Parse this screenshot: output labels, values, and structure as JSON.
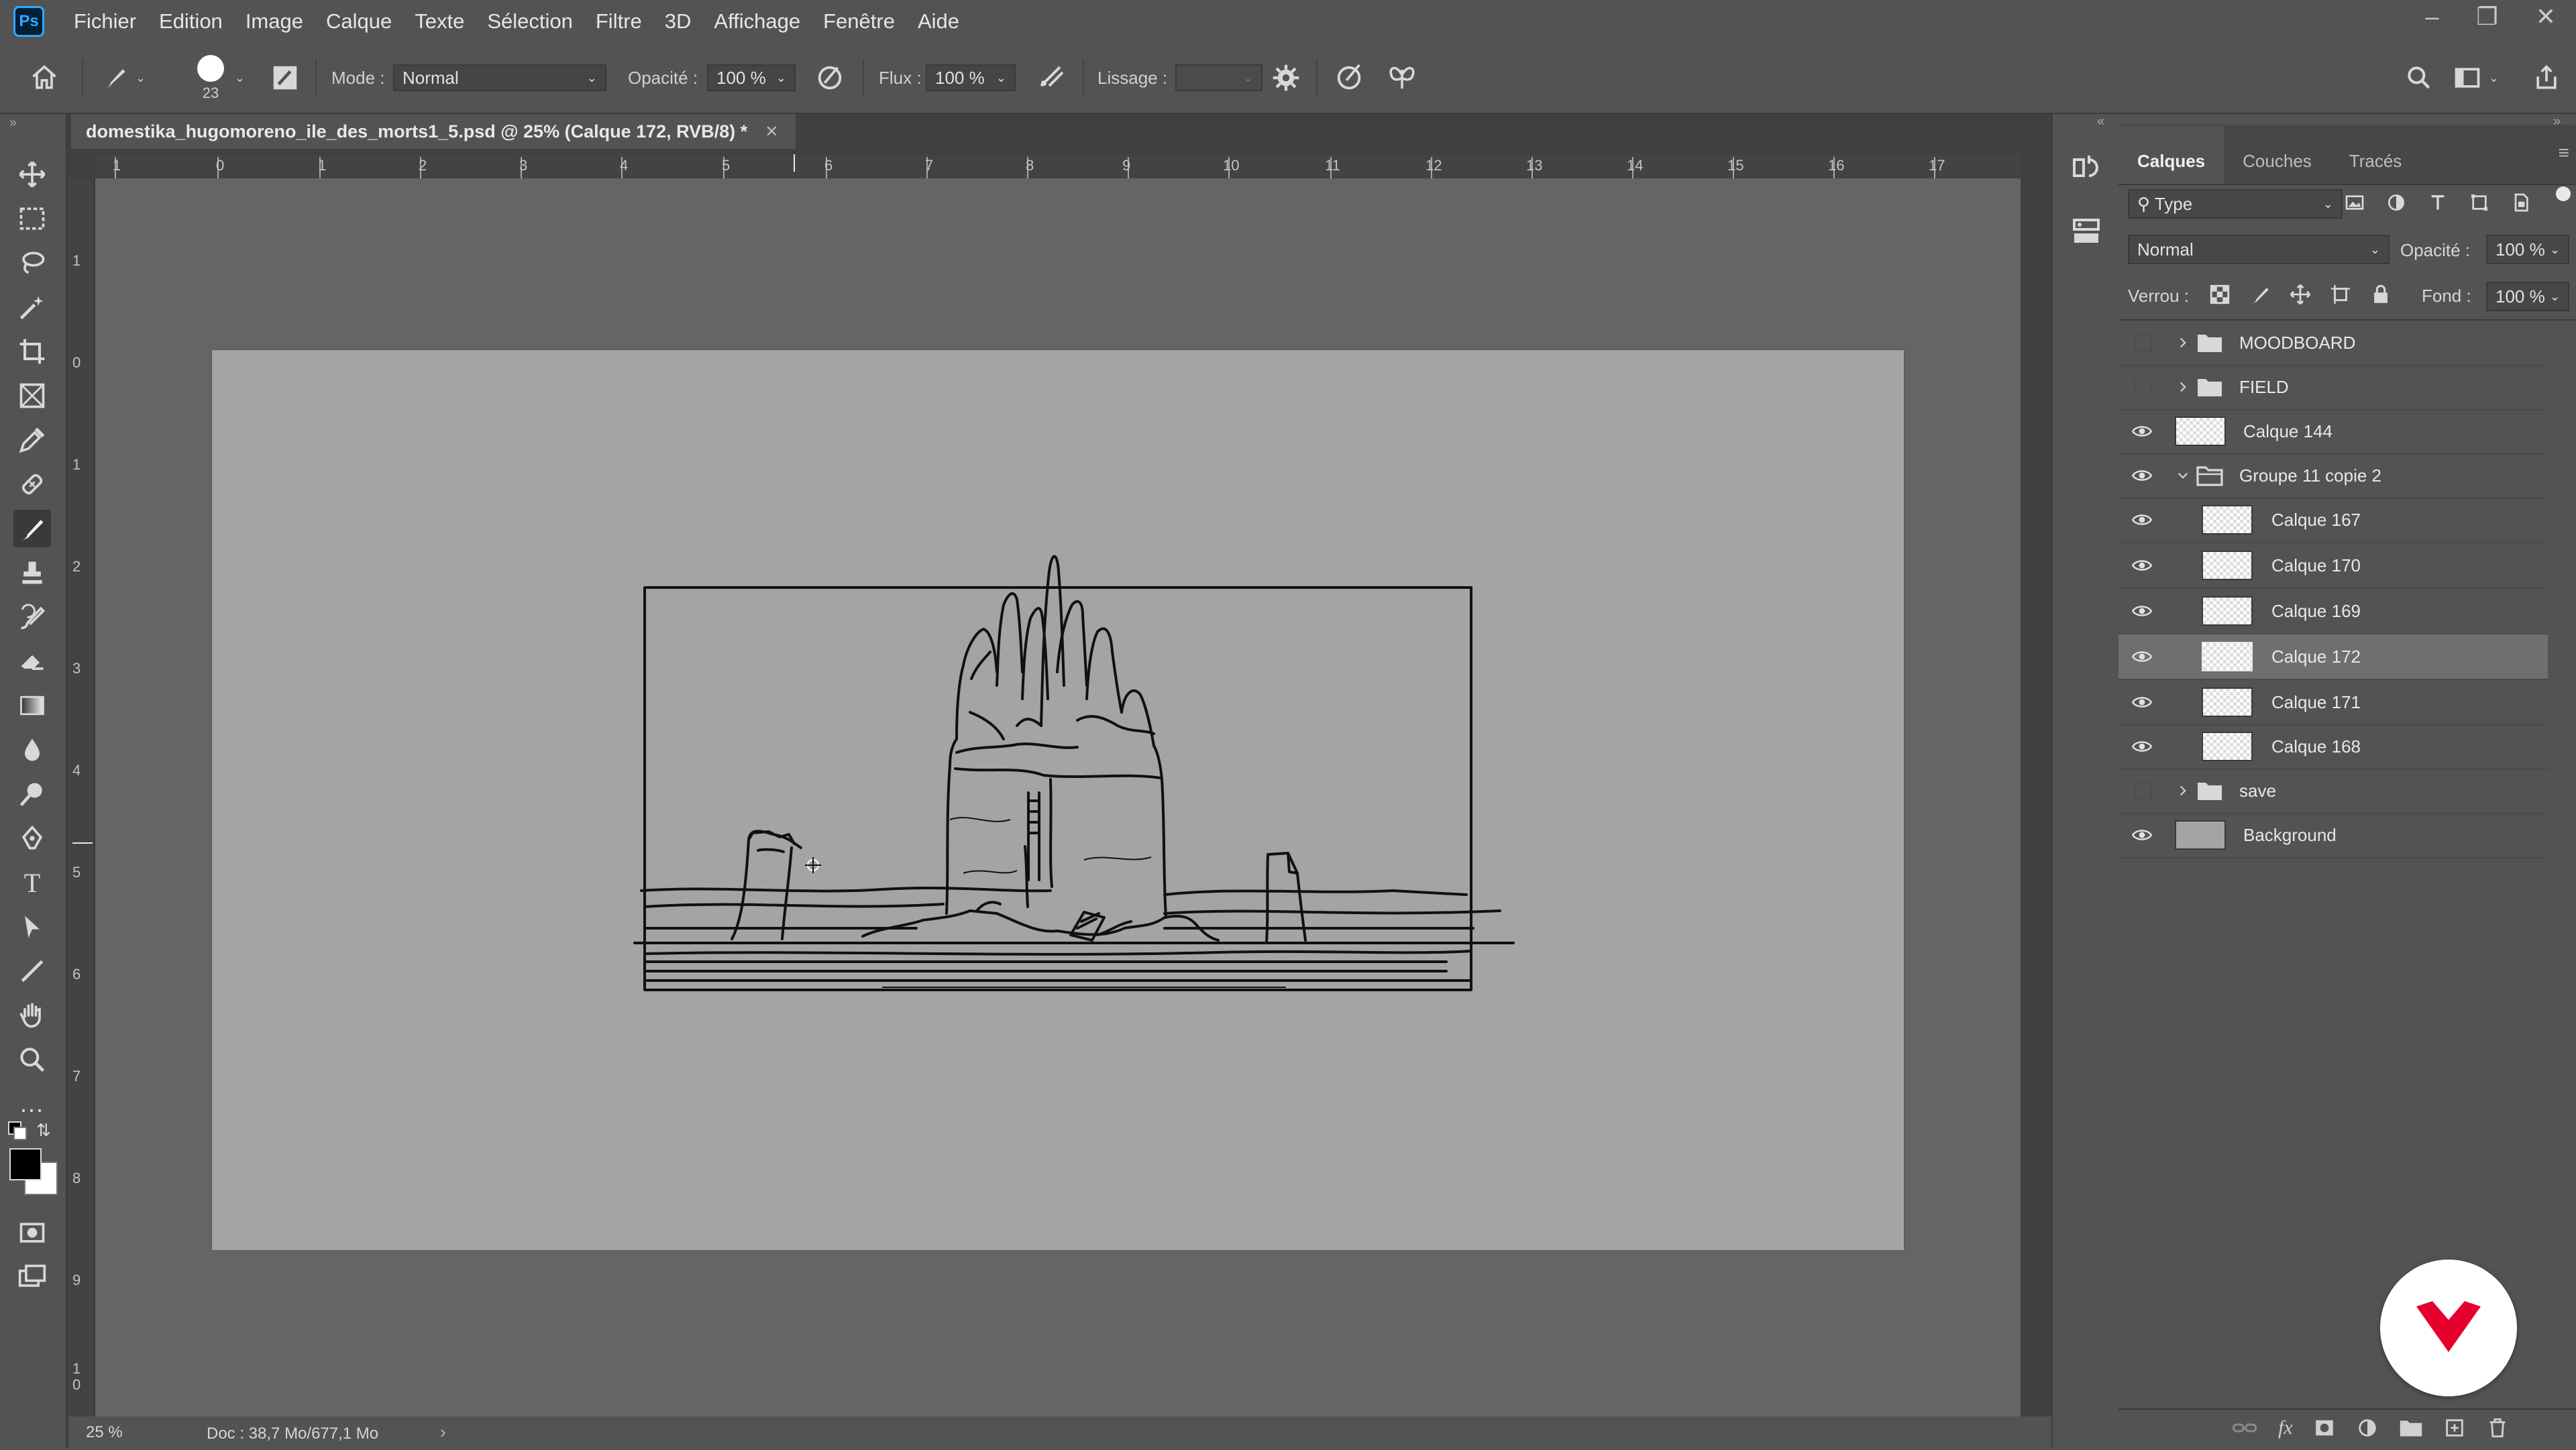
{
  "app": {
    "logo_text": "Ps"
  },
  "menu": [
    "Fichier",
    "Edition",
    "Image",
    "Calque",
    "Texte",
    "Sélection",
    "Filtre",
    "3D",
    "Affichage",
    "Fenêtre",
    "Aide"
  ],
  "options": {
    "brush_size": "23",
    "mode_label": "Mode :",
    "mode_value": "Normal",
    "opacity_label": "Opacité :",
    "opacity_value": "100 %",
    "flux_label": "Flux :",
    "flux_value": "100 %",
    "lissage_label": "Lissage :",
    "lissage_value": ""
  },
  "document": {
    "tab_title": "domestika_hugomoreno_ile_des_morts1_5.psd @ 25% (Calque 172, RVB/8) *",
    "zoom": "25 %",
    "doc_info": "Doc : 38,7 Mo/677,1 Mo",
    "ruler_top": [
      "1",
      "0",
      "1",
      "2",
      "3",
      "4",
      "5",
      "6",
      "7",
      "8",
      "9",
      "10",
      "11",
      "12",
      "13",
      "14",
      "15",
      "16",
      "17"
    ],
    "ruler_left": [
      "1",
      "0",
      "1",
      "2",
      "3",
      "4",
      "5",
      "6",
      "7",
      "8",
      "9",
      "1",
      "0"
    ]
  },
  "layers_panel": {
    "tabs": [
      "Calques",
      "Couches",
      "Tracés"
    ],
    "filter_value": "Type",
    "blend_mode": "Normal",
    "opacity_label": "Opacité :",
    "opacity_value": "100 %",
    "lock_label": "Verrou :",
    "fill_label": "Fond :",
    "fill_value": "100 %",
    "layers": [
      {
        "name": "MOODBOARD",
        "kind": "group",
        "visible": false,
        "expanded": false,
        "selected": false
      },
      {
        "name": "FIELD",
        "kind": "group",
        "visible": false,
        "expanded": false,
        "selected": false
      },
      {
        "name": "Calque 144",
        "kind": "layer",
        "visible": true,
        "selected": false
      },
      {
        "name": "Groupe 11 copie 2",
        "kind": "group",
        "visible": true,
        "expanded": true,
        "selected": false
      },
      {
        "name": "Calque 167",
        "kind": "layer",
        "visible": true,
        "selected": false
      },
      {
        "name": "Calque 170",
        "kind": "layer",
        "visible": true,
        "selected": false
      },
      {
        "name": "Calque 169",
        "kind": "layer",
        "visible": true,
        "selected": false
      },
      {
        "name": "Calque 172",
        "kind": "layer",
        "visible": true,
        "selected": true
      },
      {
        "name": "Calque 171",
        "kind": "layer",
        "visible": true,
        "selected": false
      },
      {
        "name": "Calque 168",
        "kind": "layer",
        "visible": true,
        "selected": false
      },
      {
        "name": "save",
        "kind": "group",
        "visible": false,
        "expanded": false,
        "selected": false
      },
      {
        "name": "Background",
        "kind": "background",
        "visible": true,
        "selected": false
      }
    ]
  },
  "colors": {
    "accent": "#31a8ff",
    "domestika": "#e6002e",
    "foreground": "#000000",
    "background": "#ffffff"
  }
}
